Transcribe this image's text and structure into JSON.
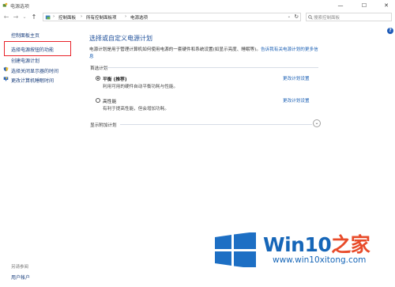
{
  "window": {
    "title": "电源选项",
    "minimize": "—",
    "maximize": "☐",
    "close": "✕"
  },
  "nav": {
    "back": "←",
    "forward": "→",
    "history": "⌄",
    "up": "↑"
  },
  "address": {
    "sep": "›",
    "crumbs": [
      "控制面板",
      "所有控制面板项",
      "电源选项"
    ],
    "dropdown": "⌄",
    "refresh": "↻"
  },
  "search": {
    "placeholder": "搜索控制面板"
  },
  "help": "?",
  "sidebar": {
    "items": [
      {
        "label": "控制面板主页"
      },
      {
        "label": "选择电源按钮的功能",
        "highlighted": true
      },
      {
        "label": "创建电源计划"
      },
      {
        "label": "选择关闭显示器的时间",
        "icon": "shield-icon"
      },
      {
        "label": "更改计算机睡眠时间",
        "icon": "moon-monitor-icon"
      }
    ],
    "see_also": "另请参阅",
    "user_accounts": "用户帐户"
  },
  "main": {
    "title": "选择或自定义电源计划",
    "desc_text": "电源计划是用于管理计算机如何使用电源的一套硬件和系统设置(如显示亮度、睡眠等)。",
    "desc_link": "告诉我有关电源计划的更多信息",
    "selected_label": "首选计划",
    "plans": [
      {
        "name": "平衡 (推荐)",
        "desc": "利用可用的硬件自动平衡功耗与性能。",
        "link": "更改计划设置",
        "checked": true
      },
      {
        "name": "高性能",
        "desc": "有利于提高性能，但会增加功耗。",
        "link": "更改计划设置",
        "checked": false
      }
    ],
    "extra_label": "显示附加计划",
    "expand": "⌄"
  },
  "watermark": {
    "brand": "Win10",
    "brand_zh": "之家",
    "url": "www.win10xitong.com",
    "colors": {
      "blue": "#1666b8",
      "orange": "#e84b2a"
    }
  },
  "colors": {
    "highlight_border": "#e8232a",
    "title_blue": "#1e4f9a",
    "link": "#1a5fb4"
  }
}
